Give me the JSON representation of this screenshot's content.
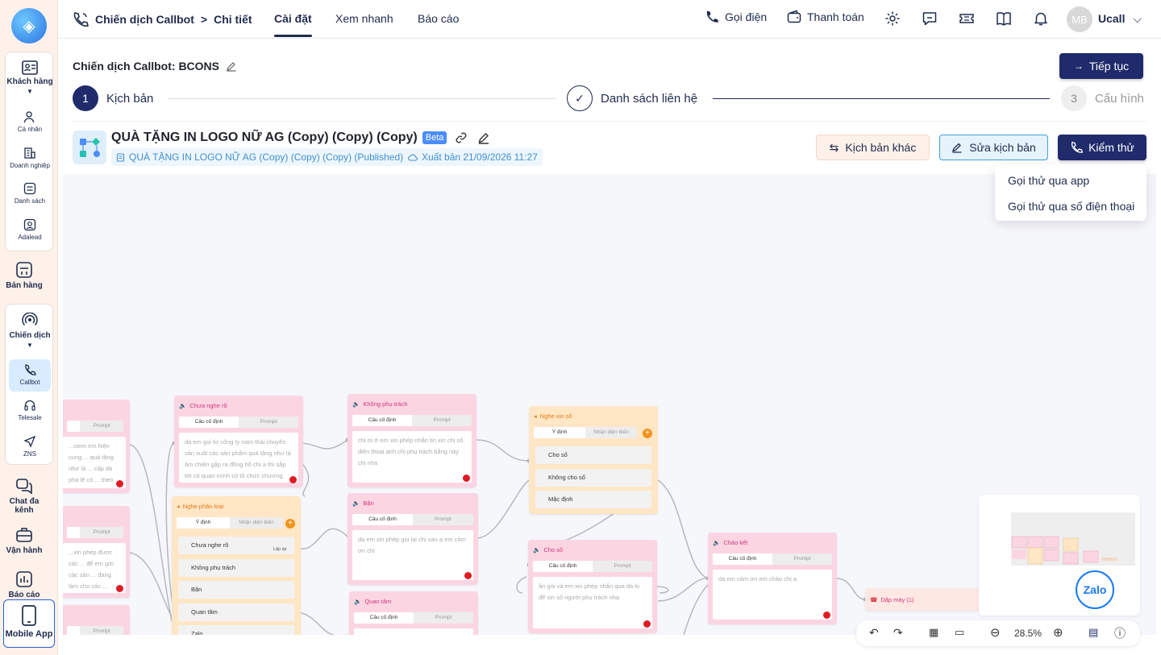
{
  "sidebar": {
    "logo_text": "◈",
    "items": [
      {
        "label": "Khách hàng",
        "icon": "contact-card-icon"
      },
      {
        "label": "Cá nhân",
        "icon": "users-icon"
      },
      {
        "label": "Doanh nghiệp",
        "icon": "building-icon"
      },
      {
        "label": "Danh sách",
        "icon": "list-icon"
      },
      {
        "label": "Adalead",
        "icon": "user-circle-icon"
      },
      {
        "label": "Bán hàng",
        "icon": "store-icon"
      },
      {
        "label": "Chiến dịch",
        "icon": "broadcast-icon"
      },
      {
        "label": "Callbot",
        "icon": "phone-icon"
      },
      {
        "label": "Telesale",
        "icon": "headset-icon"
      },
      {
        "label": "ZNS",
        "icon": "send-icon"
      },
      {
        "label": "Chat đa kênh",
        "icon": "chat-icon"
      },
      {
        "label": "Vận hành",
        "icon": "briefcase-icon"
      },
      {
        "label": "Báo cáo",
        "icon": "chart-icon"
      }
    ],
    "mobile_label": "Mobile App"
  },
  "topbar": {
    "breadcrumb_root": "Chiến dịch Callbot",
    "breadcrumb_sep": ">",
    "breadcrumb_current": "Chi tiết",
    "tabs": [
      "Cài đặt",
      "Xem nhanh",
      "Báo cáo"
    ],
    "call_label": "Gọi điện",
    "payment_label": "Thanh toán",
    "avatar_initials": "MB",
    "user_name": "Ucall"
  },
  "campaign": {
    "title": "Chiến dịch Callbot: BCONS",
    "continue_label": "Tiếp tục",
    "steps": [
      {
        "number": "1",
        "label": "Kịch bản"
      },
      {
        "number": "✓",
        "label": "Danh sách liên hệ"
      },
      {
        "number": "3",
        "label": "Cấu hình"
      }
    ]
  },
  "script": {
    "name": "QUÀ TẶNG IN LOGO NỮ AG (Copy) (Copy) (Copy)",
    "badge": "Beta",
    "published_name": "QUÀ TẶNG IN LOGO NỮ AG (Copy) (Copy) (Copy) (Published)",
    "publish_time": "Xuất bản 21/09/2026 11:27",
    "other_script_label": "Kịch bản khác",
    "edit_script_label": "Sửa kịch bản",
    "test_label": "Kiểm thử",
    "test_menu": [
      "Gọi thử qua app",
      "Gọi thử qua số điện thoại"
    ]
  },
  "flow": {
    "tab_fixed": "Câu cố định",
    "tab_prompt": "Prompt",
    "tab_intent": "Ý định",
    "tab_variable": "Nhận diện biến",
    "nodes": {
      "n0": {
        "text": "...ciem em hiện cung ... quà tặng như là ... cấp da pha lê có ... theo yêu cầu thì ... trên ..."
      },
      "n1": {
        "title": "Chưa nghe rõ",
        "text": "dạ em gọi từ công ty nam thái chuyên sản xuất các sản phẩm quà tặng như là âm chiến gập ra đồng hồ chị a thì sắp tới có quan mình có tổ chức chương trình sự kiện đặc quà..."
      },
      "n2": {
        "title": "Không phụ trách",
        "text": "chị ơi ở em xin phép nhắn tin xin chị số điện thoại anh chị phụ trách bằng này chị nha"
      },
      "n3": {
        "title": "Nghe xin số",
        "options": [
          "Cho số",
          "Không cho số",
          "Mặc định"
        ]
      },
      "n4": {
        "text": "...xin phép được các ... để em gửi các sản ... đang làm cho các ..."
      },
      "n5": {
        "title": "Nghe phân loại",
        "options": [
          "Chưa nghe rõ",
          "Không phụ trách",
          "Bận",
          "Quan tâm",
          "Zalo"
        ],
        "badge": "Lặp lại"
      },
      "n6": {
        "title": "Bận",
        "text": "dạ em xin phép gọi lại chị sau ạ em cảm ơn chị"
      },
      "n7": {
        "title": "Cho số",
        "text": "ần giá và em xin phép nhắn qua da lo để xin số người phụ trách nha"
      },
      "n8": {
        "title": "Chào kết",
        "text": "dạ em cảm ơn em chào chị ạ"
      },
      "n9": {
        "title": "Quan tâm"
      },
      "n10": {
        "title": "Dập máy (1)"
      }
    },
    "zoom": "28.5%",
    "zalo_label": "Zalo"
  }
}
